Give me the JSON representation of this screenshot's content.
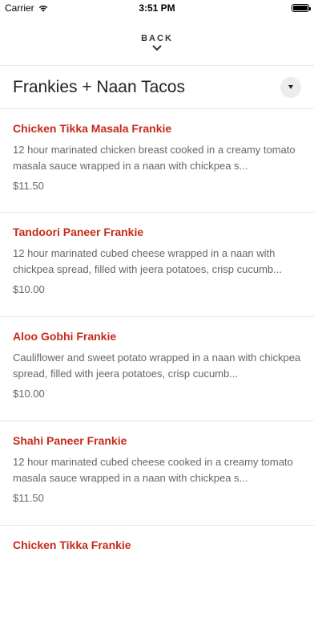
{
  "status_bar": {
    "carrier": "Carrier",
    "time": "3:51 PM"
  },
  "nav": {
    "back_label": "BACK"
  },
  "section": {
    "title": "Frankies + Naan Tacos"
  },
  "items": [
    {
      "name": "Chicken Tikka Masala Frankie",
      "description": "12 hour marinated chicken breast cooked in a creamy tomato masala sauce wrapped in a naan with chickpea s...",
      "price": "$11.50"
    },
    {
      "name": "Tandoori Paneer Frankie",
      "description": "12 hour marinated cubed cheese wrapped in a naan with chickpea spread, filled with jeera potatoes, crisp cucumb...",
      "price": "$10.00"
    },
    {
      "name": "Aloo Gobhi Frankie",
      "description": "Cauliflower and sweet potato wrapped in a naan with chickpea spread, filled with jeera potatoes, crisp cucumb...",
      "price": "$10.00"
    },
    {
      "name": "Shahi Paneer Frankie",
      "description": "12 hour marinated cubed cheese cooked in a creamy tomato masala sauce wrapped in a naan with chickpea s...",
      "price": "$11.50"
    },
    {
      "name": "Chicken Tikka Frankie",
      "description": "",
      "price": ""
    }
  ],
  "colors": {
    "accent": "#c52a19",
    "text_muted": "#666666",
    "divider": "#e6e6e6"
  },
  "icons": [
    "wifi-icon",
    "battery-icon",
    "chevron-down-icon",
    "dropdown-triangle-icon"
  ]
}
